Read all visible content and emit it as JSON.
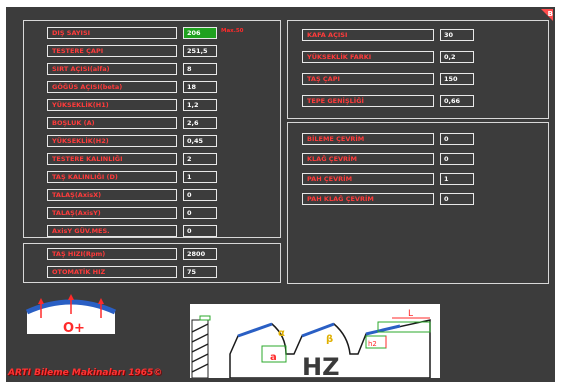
{
  "badge": "B",
  "left_fields": [
    {
      "label": "DIŞ SAYISI",
      "value": "206",
      "active": true,
      "unit": "Max.50"
    },
    {
      "label": "TESTERE ÇAPI",
      "value": "251,5"
    },
    {
      "label": "SIRT AÇISI(alfa)",
      "value": "8"
    },
    {
      "label": "GÖĞÜS AÇISI(beta)",
      "value": "18"
    },
    {
      "label": "YÜKSEKLİK(H1)",
      "value": "1,2"
    },
    {
      "label": "BOŞLUK (A)",
      "value": "2,6"
    },
    {
      "label": "YÜKSEKLİK(H2)",
      "value": "0,45"
    },
    {
      "label": "TESTERE KALINLIĞI",
      "value": "2"
    },
    {
      "label": "TAŞ KALINLIĞI (D)",
      "value": "1"
    },
    {
      "label": "TALAŞ(AxisX)",
      "value": "0"
    },
    {
      "label": "TALAŞ(AxisY)",
      "value": "0"
    },
    {
      "label": "AxisY GÜV.MES.",
      "value": "0"
    }
  ],
  "speed_fields": [
    {
      "label": "TAŞ HIZI(Rpm)",
      "value": "2800"
    },
    {
      "label": "OTOMATİK HIZ",
      "value": "75"
    }
  ],
  "right_fields": [
    {
      "label": "KAFA AÇISI",
      "value": "30"
    },
    {
      "label": "YÜKSEKLİK FARKI",
      "value": "0,2"
    },
    {
      "label": "TAŞ ÇAPI",
      "value": "150"
    },
    {
      "label": "TEPE GENİŞLİĞİ",
      "value": "0,66"
    }
  ],
  "cycle_fields": [
    {
      "label": "BİLEME ÇEVRİM",
      "value": "0"
    },
    {
      "label": "KLAĞ ÇEVRİM",
      "value": "0"
    },
    {
      "label": "PAH ÇEVRİM",
      "value": "1"
    },
    {
      "label": "PAH KLAĞ ÇEVRİM",
      "value": "0"
    }
  ],
  "diagram": {
    "blade_label": "O+",
    "alpha": "α",
    "beta": "β",
    "a": "a",
    "h2": "h2",
    "L": "L",
    "title": "HZ"
  },
  "footer": "ARTI Bileme Makinaları 1965©",
  "colors": {
    "label_text": "#ff3b3b",
    "active_value": "#1fa11f",
    "background": "#3c3c3c"
  }
}
